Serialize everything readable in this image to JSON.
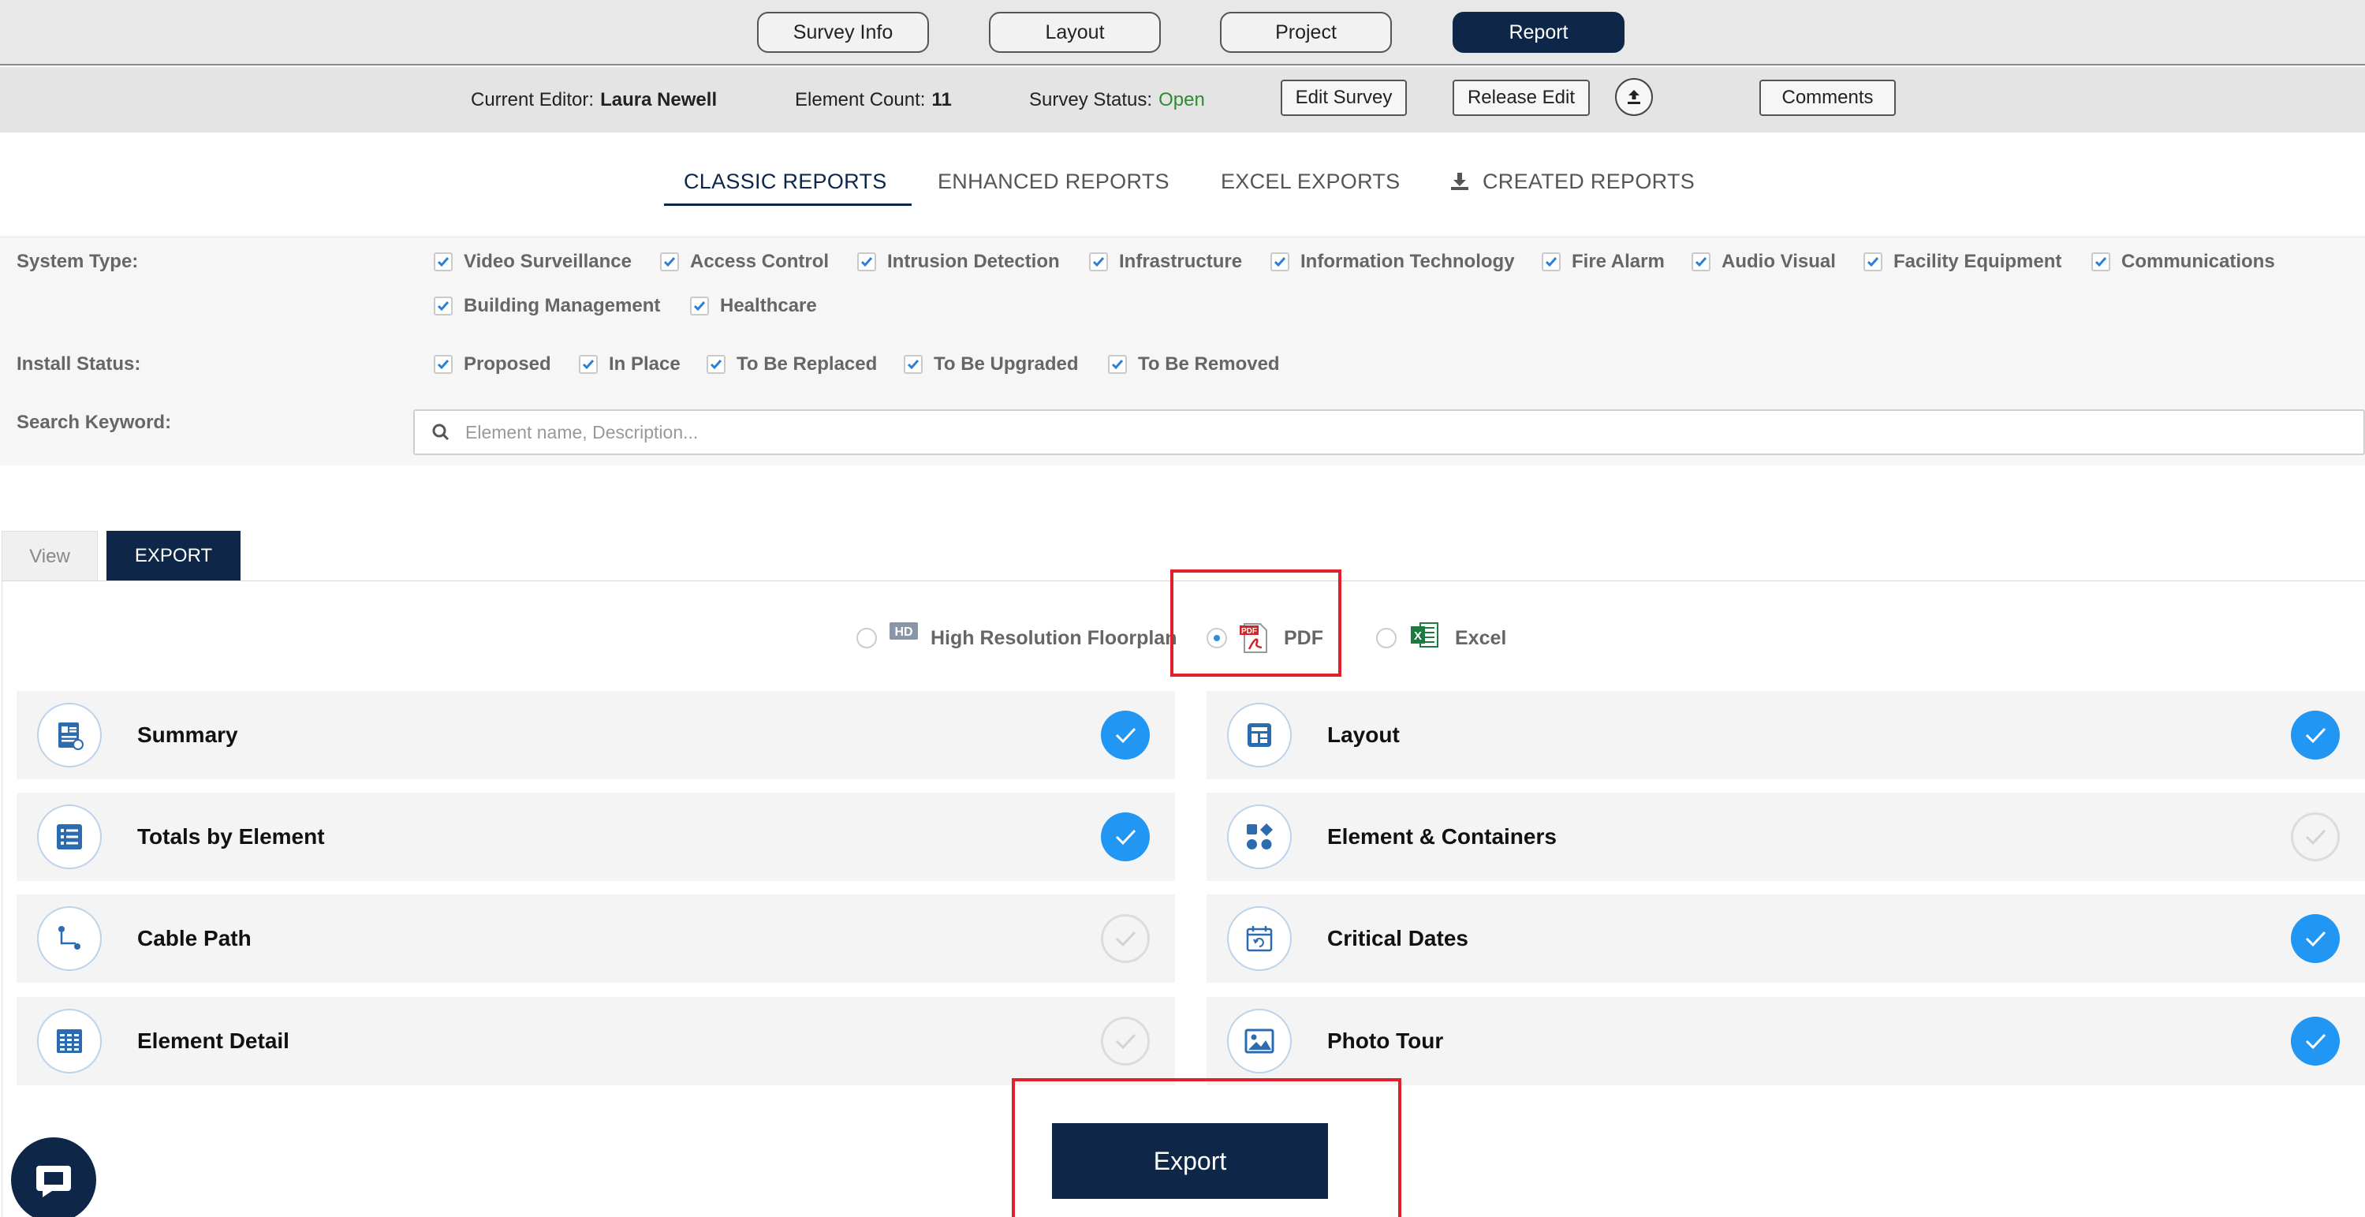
{
  "topnav": {
    "tabs": [
      {
        "label": "Survey Info"
      },
      {
        "label": "Layout"
      },
      {
        "label": "Project"
      },
      {
        "label": "Report"
      }
    ],
    "active": "Report"
  },
  "infobar": {
    "editor_label": "Current Editor:",
    "editor_name": "Laura Newell",
    "count_label": "Element Count:",
    "count_value": "11",
    "status_label": "Survey Status:",
    "status_value": "Open",
    "status_color": "#2e8b2e",
    "edit_survey": "Edit Survey",
    "release_edit": "Release Edit",
    "upload_icon": "upload-icon",
    "comments": "Comments"
  },
  "report_tabs": {
    "classic": "CLASSIC REPORTS",
    "enhanced": "ENHANCED REPORTS",
    "excel": "EXCEL EXPORTS",
    "created": "CREATED REPORTS",
    "active": "CLASSIC REPORTS"
  },
  "filters": {
    "system_type_label": "System Type:",
    "system_types": [
      "Video Surveillance",
      "Access Control",
      "Intrusion Detection",
      "Infrastructure",
      "Information Technology",
      "Fire Alarm",
      "Audio Visual",
      "Facility Equipment",
      "Communications",
      "Building Management",
      "Healthcare"
    ],
    "install_status_label": "Install Status:",
    "install_statuses": [
      "Proposed",
      "In Place",
      "To Be Replaced",
      "To Be Upgraded",
      "To Be Removed"
    ],
    "search_label": "Search Keyword:",
    "search_placeholder": "Element name, Description..."
  },
  "mode_tabs": {
    "view": "View",
    "export": "EXPORT",
    "active": "EXPORT"
  },
  "formats": {
    "hd_badge": "HD",
    "pdf_badge": "PDF",
    "excel_badge": "X",
    "options": [
      "High Resolution Floorplan",
      "PDF",
      "Excel"
    ],
    "selected": "PDF"
  },
  "reports": [
    {
      "label": "Summary",
      "checked": true,
      "icon": "summary-icon"
    },
    {
      "label": "Layout",
      "checked": true,
      "icon": "layout-icon"
    },
    {
      "label": "Totals by Element",
      "checked": true,
      "icon": "list-icon"
    },
    {
      "label": "Element & Containers",
      "checked": false,
      "icon": "shapes-icon"
    },
    {
      "label": "Cable Path",
      "checked": false,
      "icon": "cable-path-icon"
    },
    {
      "label": "Critical Dates",
      "checked": true,
      "icon": "calendar-icon"
    },
    {
      "label": "Element Detail",
      "checked": false,
      "icon": "table-icon"
    },
    {
      "label": "Photo Tour",
      "checked": true,
      "icon": "photo-icon"
    }
  ],
  "export_button": "Export",
  "colors": {
    "navy": "#0e2647",
    "check_blue": "#2196f3",
    "annotation_red": "#e0202a"
  }
}
